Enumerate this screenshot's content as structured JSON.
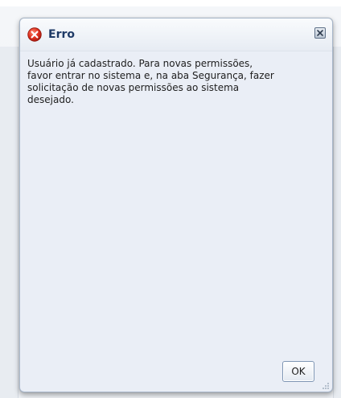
{
  "dialog": {
    "title": "Erro",
    "icon": "error-icon",
    "message": "Usuário já cadastrado. Para novas permissões,\nfavor entrar no sistema e, na aba Segurança, fazer\nsolicitação de novas permissões ao sistema\ndesejado.",
    "close_icon": "close-icon",
    "ok_label": "OK"
  },
  "colors": {
    "title_text": "#1e3a66",
    "error_red": "#d42a1e",
    "dialog_bg": "#eaeef6",
    "border": "#a9b8cb"
  }
}
